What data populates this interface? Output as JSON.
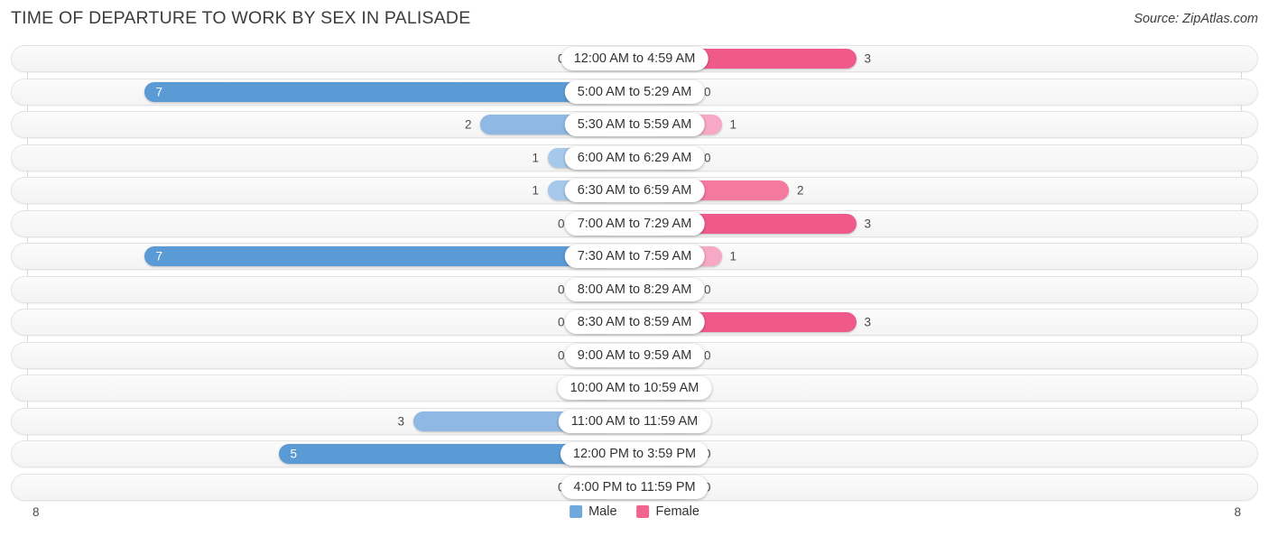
{
  "header": {
    "title": "TIME OF DEPARTURE TO WORK BY SEX IN PALISADE",
    "source": "Source: ZipAtlas.com"
  },
  "legend": {
    "male_label": "Male",
    "female_label": "Female",
    "male_color": "#6fa8dc",
    "female_color": "#f2648f"
  },
  "axis": {
    "left_max_label": "8",
    "right_max_label": "8"
  },
  "chart_data": {
    "type": "bar",
    "orientation": "horizontal-diverging",
    "title": "TIME OF DEPARTURE TO WORK BY SEX IN PALISADE",
    "xlabel": "",
    "ylabel": "",
    "xlim": [
      8,
      8
    ],
    "grid": false,
    "legend_position": "bottom-center",
    "categories": [
      "12:00 AM to 4:59 AM",
      "5:00 AM to 5:29 AM",
      "5:30 AM to 5:59 AM",
      "6:00 AM to 6:29 AM",
      "6:30 AM to 6:59 AM",
      "7:00 AM to 7:29 AM",
      "7:30 AM to 7:59 AM",
      "8:00 AM to 8:29 AM",
      "8:30 AM to 8:59 AM",
      "9:00 AM to 9:59 AM",
      "10:00 AM to 10:59 AM",
      "11:00 AM to 11:59 AM",
      "12:00 PM to 3:59 PM",
      "4:00 PM to 11:59 PM"
    ],
    "series": [
      {
        "name": "Male",
        "values": [
          0,
          7,
          2,
          1,
          1,
          0,
          7,
          0,
          0,
          0,
          0,
          3,
          5,
          0
        ]
      },
      {
        "name": "Female",
        "values": [
          3,
          0,
          1,
          0,
          2,
          3,
          1,
          0,
          3,
          0,
          0,
          0,
          0,
          0
        ]
      }
    ]
  },
  "rows": [
    {
      "label": "12:00 AM to 4:59 AM",
      "male": "0",
      "female": "3"
    },
    {
      "label": "5:00 AM to 5:29 AM",
      "male": "7",
      "female": "0"
    },
    {
      "label": "5:30 AM to 5:59 AM",
      "male": "2",
      "female": "1"
    },
    {
      "label": "6:00 AM to 6:29 AM",
      "male": "1",
      "female": "0"
    },
    {
      "label": "6:30 AM to 6:59 AM",
      "male": "1",
      "female": "2"
    },
    {
      "label": "7:00 AM to 7:29 AM",
      "male": "0",
      "female": "3"
    },
    {
      "label": "7:30 AM to 7:59 AM",
      "male": "7",
      "female": "1"
    },
    {
      "label": "8:00 AM to 8:29 AM",
      "male": "0",
      "female": "0"
    },
    {
      "label": "8:30 AM to 8:59 AM",
      "male": "0",
      "female": "3"
    },
    {
      "label": "9:00 AM to 9:59 AM",
      "male": "0",
      "female": "0"
    },
    {
      "label": "10:00 AM to 10:59 AM",
      "male": "0",
      "female": "0"
    },
    {
      "label": "11:00 AM to 11:59 AM",
      "male": "3",
      "female": "0"
    },
    {
      "label": "12:00 PM to 3:59 PM",
      "male": "5",
      "female": "0"
    },
    {
      "label": "4:00 PM to 11:59 PM",
      "male": "0",
      "female": "0"
    }
  ]
}
